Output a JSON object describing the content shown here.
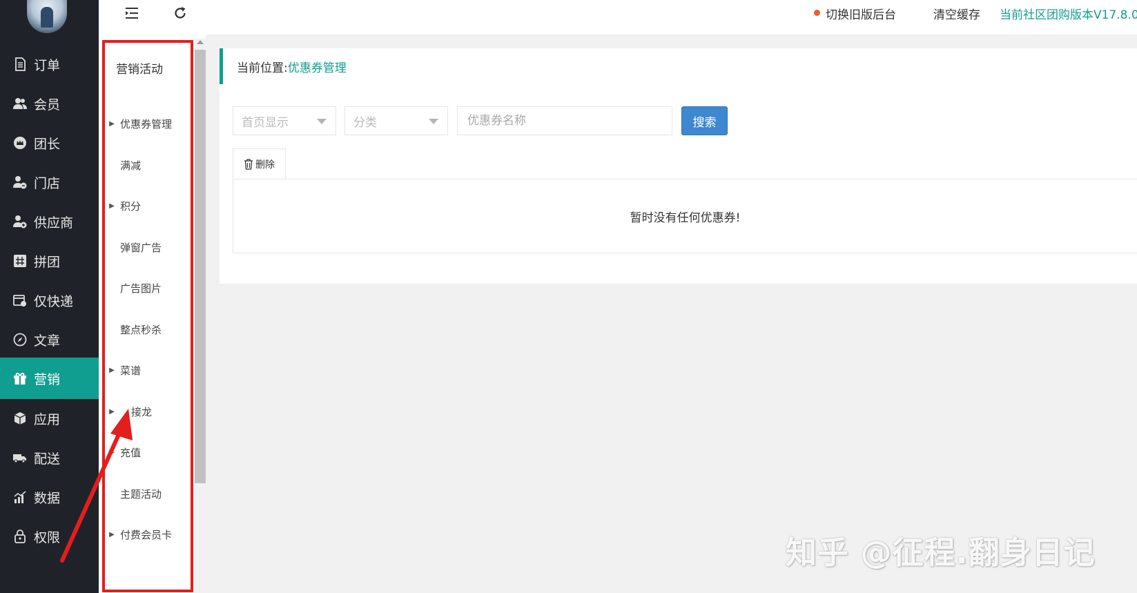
{
  "nav": {
    "items": [
      {
        "label": "订单",
        "icon": "document-icon"
      },
      {
        "label": "会员",
        "icon": "users-icon"
      },
      {
        "label": "团长",
        "icon": "crown-icon"
      },
      {
        "label": "门店",
        "icon": "store-person-icon"
      },
      {
        "label": "供应商",
        "icon": "supplier-person-icon"
      },
      {
        "label": "拼团",
        "icon": "group-buy-icon"
      },
      {
        "label": "仅快递",
        "icon": "shop-express-icon"
      },
      {
        "label": "文章",
        "icon": "compass-icon"
      },
      {
        "label": "营销",
        "icon": "gift-icon",
        "active": true
      },
      {
        "label": "应用",
        "icon": "cube-icon"
      },
      {
        "label": "配送",
        "icon": "truck-icon"
      },
      {
        "label": "数据",
        "icon": "chart-icon"
      },
      {
        "label": "权限",
        "icon": "lock-icon"
      }
    ]
  },
  "submenu": {
    "title": "营销活动",
    "items": [
      {
        "label": "优惠券管理",
        "caret": true
      },
      {
        "label": "满减",
        "caret": false
      },
      {
        "label": "积分",
        "caret": true
      },
      {
        "label": "弹窗广告",
        "caret": false
      },
      {
        "label": "广告图片",
        "caret": false
      },
      {
        "label": "整点秒杀",
        "caret": false
      },
      {
        "label": "菜谱",
        "caret": true
      },
      {
        "label": "接龙",
        "caret": true
      },
      {
        "label": "充值",
        "caret": true
      },
      {
        "label": "主题活动",
        "caret": false
      },
      {
        "label": "付费会员卡",
        "caret": true
      }
    ]
  },
  "topbar": {
    "switch_label": "切换旧版后台",
    "clear_cache_label": "清空缓存",
    "version_label": "当前社区团购版本V17.8.0"
  },
  "breadcrumb": {
    "prefix": "当前位置:",
    "current": "优惠券管理"
  },
  "filters": {
    "home_display": "首页显示",
    "category": "分类",
    "name_placeholder": "优惠券名称",
    "search_label": "搜索"
  },
  "actions": {
    "delete_label": "删除"
  },
  "empty_message": "暂时没有任何优惠券!",
  "watermark": "知乎 @征程.翻身日记",
  "colors": {
    "accent": "#0f9e8f",
    "sidebar": "#1f2329",
    "annotation": "#e41d1d",
    "primary_button": "#3d88d0"
  }
}
